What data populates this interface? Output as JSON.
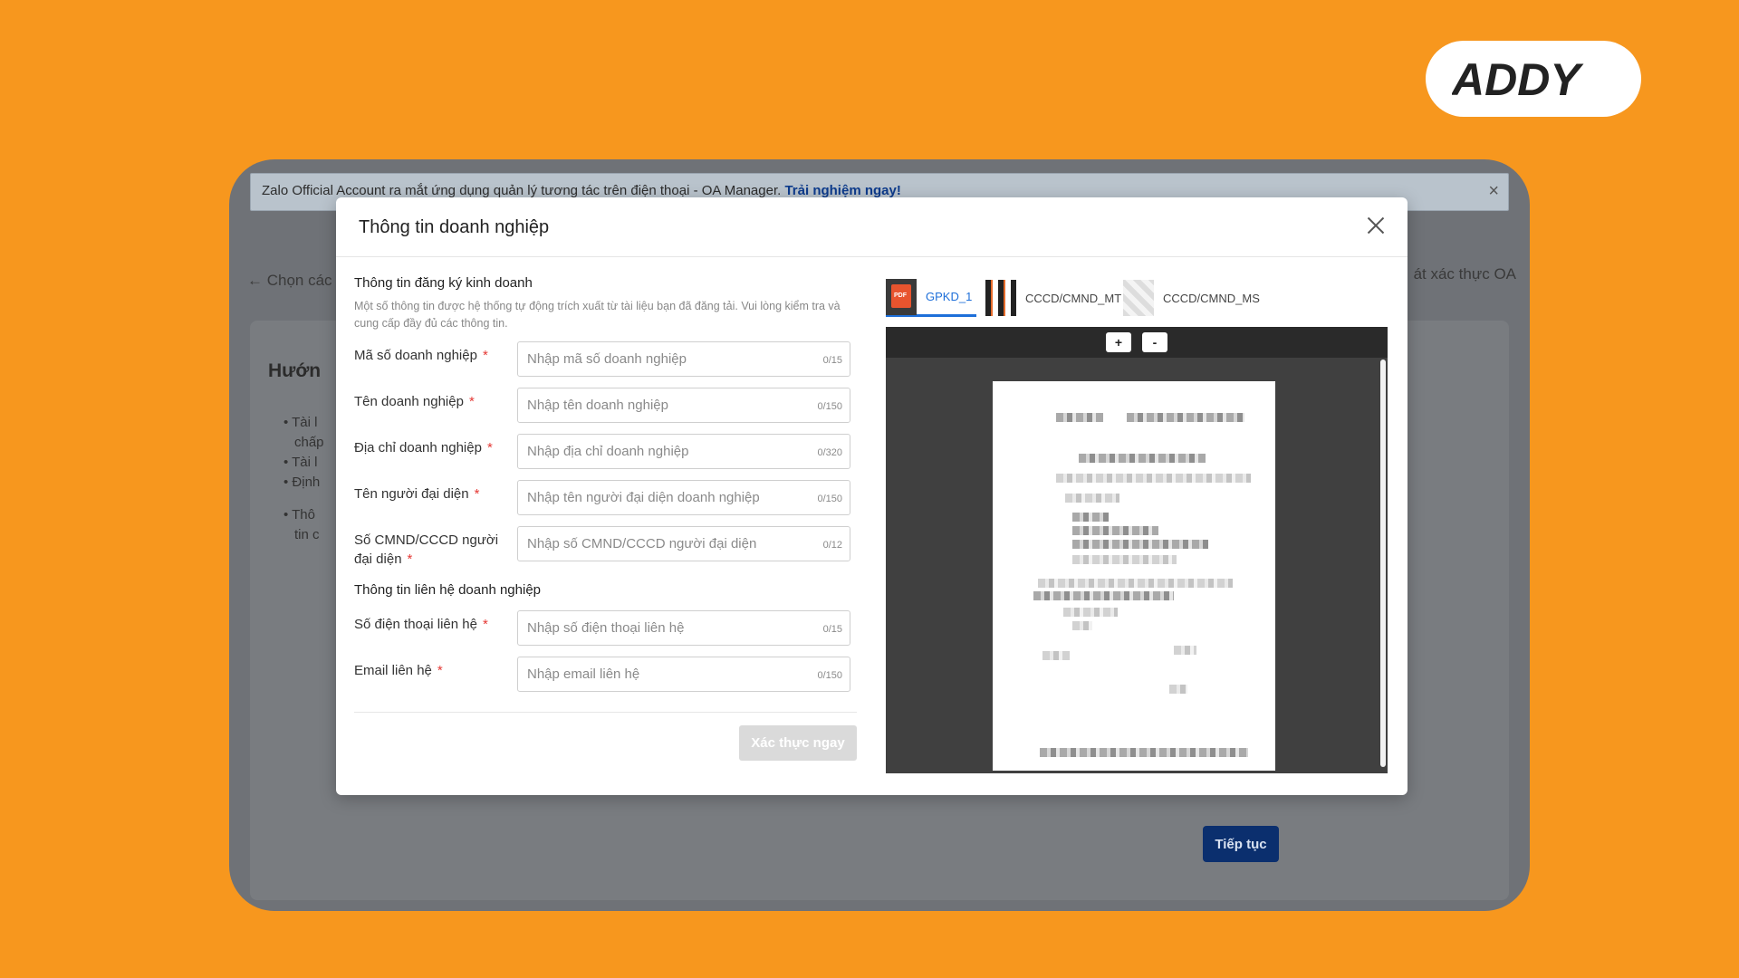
{
  "brand": {
    "logo_text": "ADDY"
  },
  "background": {
    "banner_text": "Zalo Official Account ra mắt ứng dụng quản lý tương tác trên điện thoại - OA Manager.",
    "banner_link": "Trải nghiệm ngay!",
    "back_label": "← Chọn các",
    "right_title": "át xác thực OA",
    "card_heading": "Hướn",
    "list_items": [
      "• Tài l",
      "chấp",
      "• Tài l",
      "• Định",
      "",
      "• Thô",
      "tin c"
    ],
    "continue_label": "Tiếp tục"
  },
  "modal": {
    "title": "Thông tin doanh nghiệp",
    "section1_title": "Thông tin đăng ký kinh doanh",
    "section1_desc": "Một số thông tin được hệ thống tự động trích xuất từ tài liệu bạn đã đăng tải. Vui lòng kiểm tra và cung cấp đầy đủ các thông tin.",
    "fields": [
      {
        "label": "Mã số doanh nghiệp",
        "placeholder": "Nhập mã số doanh nghiệp",
        "counter": "0/15"
      },
      {
        "label": "Tên doanh nghiệp",
        "placeholder": "Nhập tên doanh nghiệp",
        "counter": "0/150"
      },
      {
        "label": "Địa chỉ doanh nghiệp",
        "placeholder": "Nhập địa chỉ doanh nghiệp",
        "counter": "0/320"
      },
      {
        "label": "Tên người đại diện",
        "placeholder": "Nhập tên người đại diện doanh nghiệp",
        "counter": "0/150"
      },
      {
        "label": "Số CMND/CCCD người đại diện",
        "placeholder": "Nhập số CMND/CCCD người đại diện",
        "counter": "0/12"
      }
    ],
    "section2_title": "Thông tin liên hệ doanh nghiệp",
    "contact_fields": [
      {
        "label": "Số điện thoại liên hệ",
        "placeholder": "Nhập số điện thoại liên hệ",
        "counter": "0/15"
      },
      {
        "label": "Email liên hệ",
        "placeholder": "Nhập email liên hệ",
        "counter": "0/150"
      }
    ],
    "required_mark": "*",
    "verify_label": "Xác thực ngay",
    "doc_tabs": [
      {
        "label": "GPKD_1",
        "thumb_label": "PDF"
      },
      {
        "label": "CCCD/CMND_MT"
      },
      {
        "label": "CCCD/CMND_MS"
      }
    ],
    "zoom_in": "+",
    "zoom_out": "-"
  },
  "colors": {
    "background": "#f7971e",
    "accent": "#1e6fd9",
    "required": "#e53935",
    "continue_button": "#0b2f6e"
  }
}
